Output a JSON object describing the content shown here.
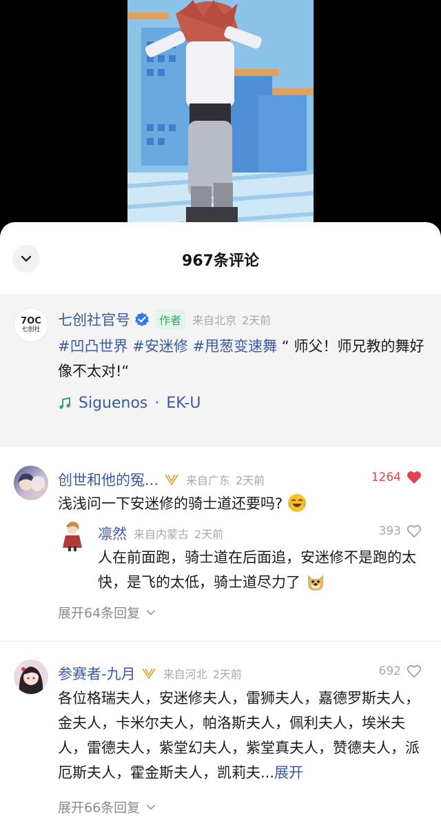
{
  "sheet": {
    "title": "967条评论"
  },
  "pinned_comment": {
    "author": "七创社官号",
    "author_badge": "作者",
    "location": "来自北京",
    "time": "2天前",
    "tags": [
      "#凹凸世界",
      "#安迷修",
      "#甩葱变速舞"
    ],
    "text": "“ 师父！师兄教的舞好像不太对!“",
    "music_title": "Siguenos",
    "music_sep": "·",
    "music_artist": "EK-U",
    "avatar_text_top": "7OC",
    "avatar_text_bottom": "七创社"
  },
  "comments": [
    {
      "author": "创世和他的冤...",
      "location": "来自广东",
      "time": "2天前",
      "likes": "1264",
      "liked": true,
      "text": "浅浅问一下安迷修的骑士道还要吗?",
      "reply": {
        "author": "凛然",
        "location": "来自内蒙古",
        "time": "2天前",
        "likes": "393",
        "text": "人在前面跑，骑士道在后面追，安迷修不是跑的太快，是飞的太低，骑士道尽力了"
      },
      "expand_label": "展开64条回复"
    },
    {
      "author": "参赛者-九月",
      "location": "来自河北",
      "time": "2天前",
      "likes": "692",
      "liked": false,
      "text": "各位格瑞夫人，安迷修夫人，雷狮夫人，嘉德罗斯夫人，金夫人，卡米尔夫人，帕洛斯夫人，佩利夫人，埃米夫人，雷德夫人，紫堂幻夫人，紫堂真夫人，赞德夫人，派厄斯夫人，霍金斯夫人，凯莉夫...",
      "more_label": "展开",
      "expand_label": "展开66条回复"
    }
  ]
}
